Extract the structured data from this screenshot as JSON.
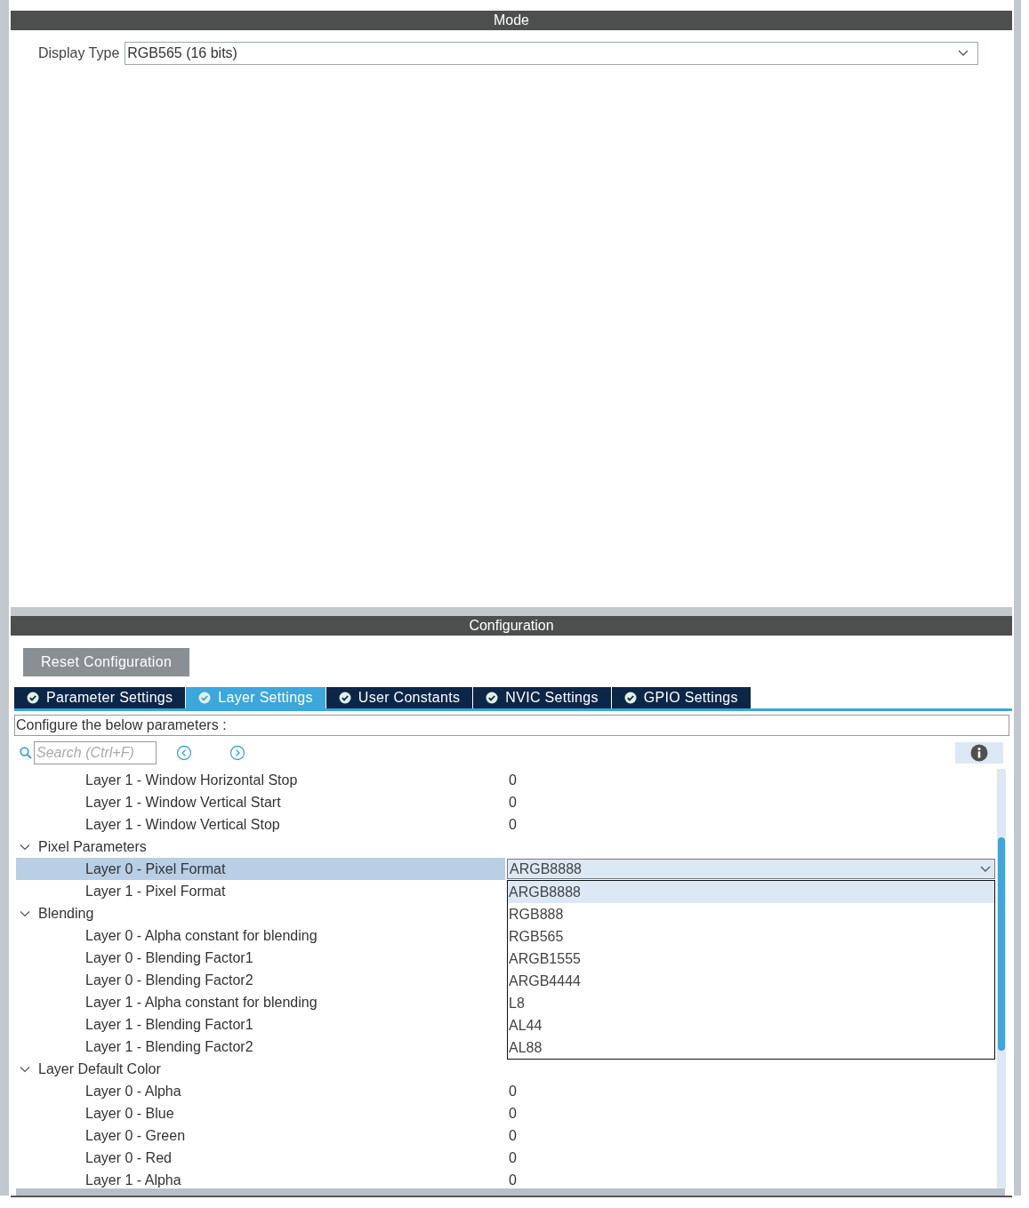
{
  "mode": {
    "title": "Mode",
    "display_type": {
      "label": "Display Type",
      "value": "RGB565 (16 bits)"
    }
  },
  "configuration": {
    "title": "Configuration",
    "reset_button": "Reset Configuration",
    "tabs": [
      {
        "label": "Parameter Settings",
        "selected": false
      },
      {
        "label": "Layer Settings",
        "selected": true
      },
      {
        "label": "User Constants",
        "selected": false
      },
      {
        "label": "NVIC Settings",
        "selected": false
      },
      {
        "label": "GPIO Settings",
        "selected": false
      }
    ],
    "description": "Configure the below parameters :",
    "search": {
      "placeholder": "Search (Ctrl+F)"
    },
    "tree": [
      {
        "kind": "continued",
        "children": [
          {
            "label": "Layer 1 - Window Horizontal Stop",
            "value": "0",
            "selected": false
          },
          {
            "label": "Layer 1 - Window Vertical Start",
            "value": "0",
            "selected": false
          },
          {
            "label": "Layer 1 - Window Vertical Stop",
            "value": "0",
            "selected": false
          }
        ]
      },
      {
        "kind": "group",
        "label": "Pixel Parameters",
        "expanded": true,
        "children": [
          {
            "label": "Layer 0 - Pixel Format",
            "value": "ARGB8888",
            "selected": true,
            "dropdown": {
              "options": [
                {
                  "label": "ARGB8888",
                  "selected": true
                },
                {
                  "label": "RGB888",
                  "selected": false
                },
                {
                  "label": "RGB565",
                  "selected": false
                },
                {
                  "label": "ARGB1555",
                  "selected": false
                },
                {
                  "label": "ARGB4444",
                  "selected": false
                },
                {
                  "label": "L8",
                  "selected": false
                },
                {
                  "label": "AL44",
                  "selected": false
                },
                {
                  "label": "AL88",
                  "selected": false
                }
              ]
            }
          },
          {
            "label": "Layer 1 - Pixel Format",
            "selected": false
          }
        ]
      },
      {
        "kind": "group",
        "label": "Blending",
        "expanded": true,
        "children": [
          {
            "label": "Layer 0 - Alpha constant for blending",
            "selected": false
          },
          {
            "label": "Layer 0 - Blending Factor1",
            "selected": false
          },
          {
            "label": "Layer 0 - Blending Factor2",
            "selected": false
          },
          {
            "label": "Layer 1 - Alpha constant for blending",
            "selected": false
          },
          {
            "label": "Layer 1 - Blending Factor1",
            "selected": false
          },
          {
            "label": "Layer 1 - Blending Factor2",
            "selected": false
          }
        ]
      },
      {
        "kind": "group",
        "label": "Layer Default Color",
        "expanded": true,
        "children": [
          {
            "label": "Layer 0 - Alpha",
            "value": "0",
            "selected": false
          },
          {
            "label": "Layer 0 - Blue",
            "value": "0",
            "selected": false
          },
          {
            "label": "Layer 0 - Green",
            "value": "0",
            "selected": false
          },
          {
            "label": "Layer 0 - Red",
            "value": "0",
            "selected": false
          },
          {
            "label": "Layer 1 - Alpha",
            "value": "0",
            "selected": false
          }
        ]
      }
    ]
  }
}
